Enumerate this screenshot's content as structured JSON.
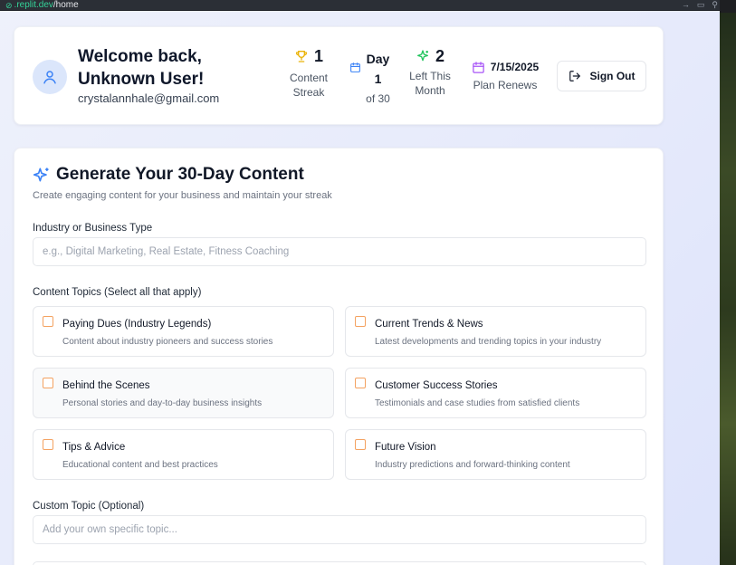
{
  "browser": {
    "url_host": ".replit.dev",
    "url_path": "/home"
  },
  "header": {
    "welcome": "Welcome back, Unknown User!",
    "email": "crystalannhale@gmail.com",
    "stats": {
      "streak": {
        "value": "1",
        "label_line1": "Content",
        "label_line2": "Streak"
      },
      "day": {
        "word": "Day",
        "value": "1",
        "of": "of 30"
      },
      "left": {
        "value": "2",
        "label_line1": "Left This",
        "label_line2": "Month"
      },
      "plan": {
        "date": "7/15/2025",
        "label": "Plan Renews"
      }
    },
    "sign_out_label": "Sign Out"
  },
  "generator": {
    "title": "Generate Your 30-Day Content",
    "subtitle": "Create engaging content for your business and maintain your streak",
    "industry_label": "Industry or Business Type",
    "industry_placeholder": "e.g., Digital Marketing, Real Estate, Fitness Coaching",
    "topics_label": "Content Topics (Select all that apply)",
    "topics": [
      {
        "title": "Paying Dues (Industry Legends)",
        "desc": "Content about industry pioneers and success stories",
        "checked": false
      },
      {
        "title": "Current Trends & News",
        "desc": "Latest developments and trending topics in your industry",
        "checked": false
      },
      {
        "title": "Behind the Scenes",
        "desc": "Personal stories and day-to-day business insights",
        "checked": false
      },
      {
        "title": "Customer Success Stories",
        "desc": "Testimonials and case studies from satisfied clients",
        "checked": false
      },
      {
        "title": "Tips & Advice",
        "desc": "Educational content and best practices",
        "checked": false
      },
      {
        "title": "Future Vision",
        "desc": "Industry predictions and forward-thinking content",
        "checked": false
      }
    ],
    "custom_label": "Custom Topic (Optional)",
    "custom_placeholder": "Add your own specific topic..."
  },
  "colors": {
    "accent_blue": "#3b82f6",
    "trophy_yellow": "#eab308",
    "sparkle_green": "#22c55e",
    "calendar_purple": "#a855f7",
    "checkbox_orange": "#f4a261"
  }
}
